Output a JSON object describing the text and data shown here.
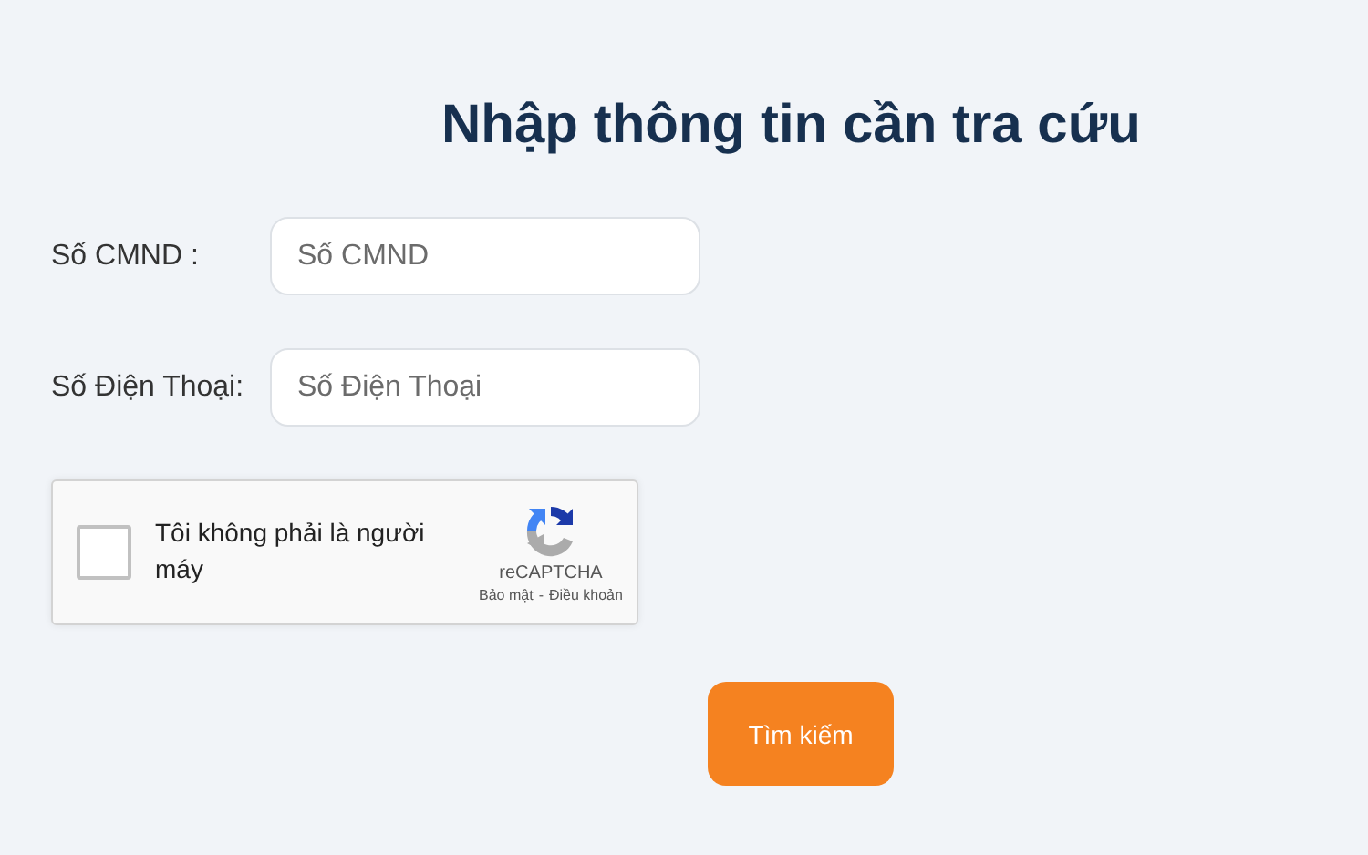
{
  "title": "Nhập thông tin cần tra cứu",
  "fields": [
    {
      "label": "Số CMND :",
      "placeholder": "Số CMND"
    },
    {
      "label": "Số Điện Thoại:",
      "placeholder": "Số Điện Thoại"
    }
  ],
  "captcha": {
    "checked": false,
    "label": "Tôi không phải là người máy",
    "brand": "reCAPTCHA",
    "links": [
      "Bảo mật",
      "Điều khoản"
    ],
    "separator": "-"
  },
  "submit": "Tìm kiếm"
}
